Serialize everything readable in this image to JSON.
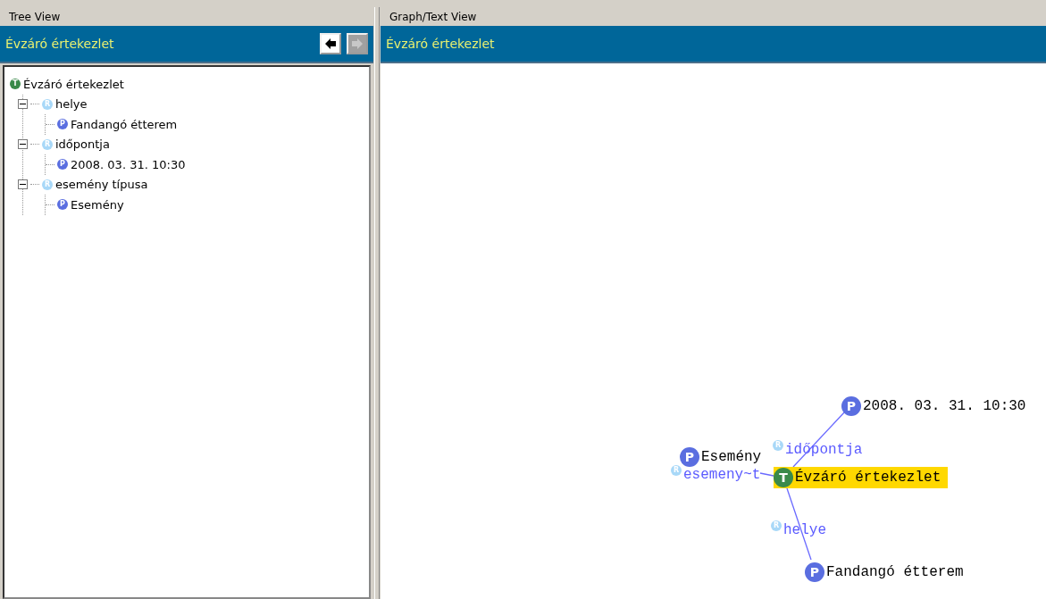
{
  "tree_panel": {
    "title": "Tree View",
    "header": "Évzáró értekezlet",
    "nav": [
      {
        "kind": "back",
        "disabled": false
      },
      {
        "kind": "forward",
        "disabled": true
      }
    ],
    "tree": [
      {
        "kind": "topic",
        "badge": "T",
        "label": "Évzáró értekezlet",
        "children": [
          {
            "kind": "role",
            "badge": "R",
            "label": "helye",
            "expanded": true,
            "children": [
              {
                "kind": "player",
                "badge": "P",
                "label": "Fandangó étterem"
              }
            ]
          },
          {
            "kind": "role",
            "badge": "R",
            "label": "időpontja",
            "expanded": true,
            "children": [
              {
                "kind": "player",
                "badge": "P",
                "label": "2008. 03. 31. 10:30"
              }
            ]
          },
          {
            "kind": "role",
            "badge": "R",
            "label": "esemény típusa",
            "expanded": true,
            "children": [
              {
                "kind": "player",
                "badge": "P",
                "label": "Esemény"
              }
            ]
          }
        ]
      }
    ]
  },
  "graph_panel": {
    "title": "Graph/Text View",
    "header": "Évzáró értekezlet",
    "nodes": [
      {
        "kind": "player",
        "badge": "P",
        "label": "2008. 03. 31. 10:30",
        "selected": false
      },
      {
        "kind": "role",
        "badge": "R",
        "label": "időpontja",
        "selected": false
      },
      {
        "kind": "player",
        "badge": "P",
        "label": "Esemény",
        "selected": false
      },
      {
        "kind": "role",
        "badge": "R",
        "label": "esemeny~t",
        "selected": false
      },
      {
        "kind": "topic",
        "badge": "T",
        "label": "Évzáró értekezlet",
        "selected": true
      },
      {
        "kind": "role",
        "badge": "R",
        "label": "helye",
        "selected": false
      },
      {
        "kind": "player",
        "badge": "P",
        "label": "Fandangó étterem",
        "selected": false
      }
    ]
  }
}
